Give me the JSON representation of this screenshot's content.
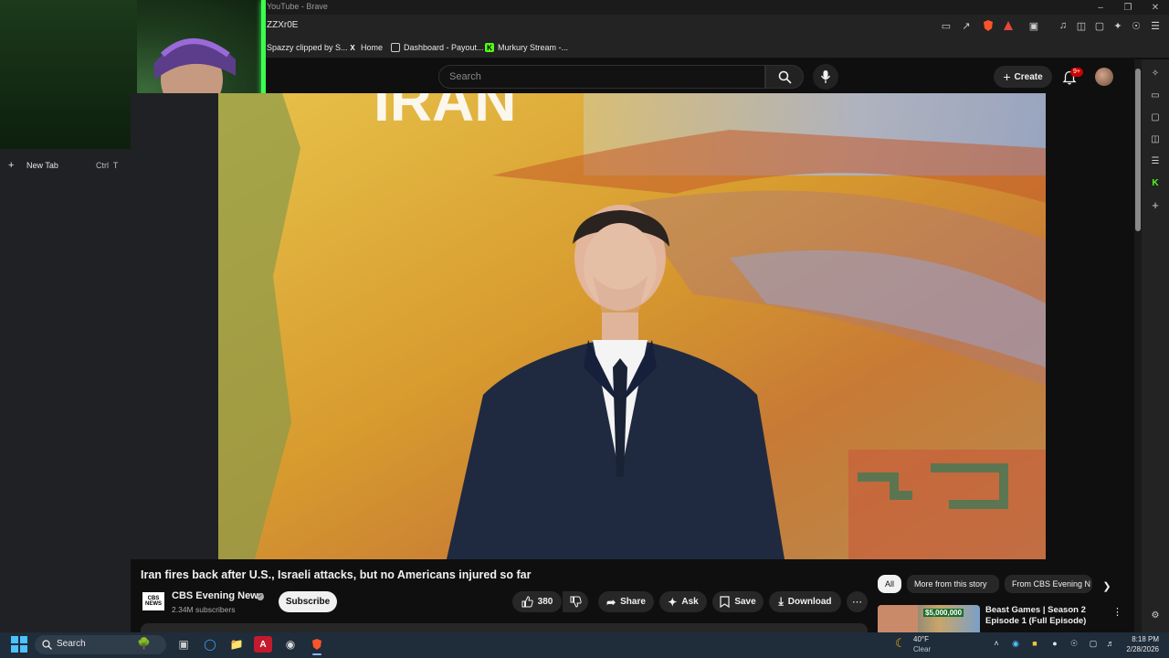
{
  "browser": {
    "window_title": "YouTube - Brave",
    "url_fragment": "ZZXr0E"
  },
  "bookmarks": [
    {
      "label": "Spazzy clipped by S...",
      "icon": "clip-icon"
    },
    {
      "label": "Home",
      "icon": "x-logo-icon"
    },
    {
      "label": "Dashboard - Payout...",
      "icon": "dashboard-icon"
    },
    {
      "label": "Murkury Stream -...",
      "icon": "kick-logo-icon"
    }
  ],
  "sidebar": {
    "new_tab_label": "New Tab",
    "new_tab_shortcut": "Ctrl  T"
  },
  "youtube": {
    "search_placeholder": "Search",
    "create_label": "Create",
    "notification_count": "9+"
  },
  "video": {
    "title": "Iran fires back after U.S., Israeli attacks, but no Americans injured so far",
    "overlay_text": "IRAN",
    "channel_name": "CBS Evening News",
    "channel_logo_text": "CBS NEWS",
    "subscribers": "2.34M subscribers",
    "subscribe_label": "Subscribe",
    "like_count": "380",
    "share_label": "Share",
    "ask_label": "Ask",
    "save_label": "Save",
    "download_label": "Download"
  },
  "related": {
    "chips": [
      "All",
      "More from this story",
      "From CBS Evening N"
    ],
    "active_chip": "All",
    "first_video_title": "Beast Games | Season 2 Episode 1 (Full Episode)",
    "first_video_thumb_text": "$5,000,000"
  },
  "taskbar": {
    "search_label": "Search",
    "weather_temp": "40°F",
    "weather_cond": "Clear",
    "time": "8:18 PM",
    "date": "2/28/2026"
  },
  "colors": {
    "youtube_bg": "#0f0f0f",
    "webcam_glow": "#3bff4f",
    "brave_orange": "#fb542b",
    "notification_red": "#cc0000"
  }
}
